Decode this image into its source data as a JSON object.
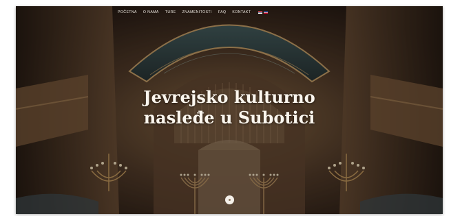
{
  "nav": {
    "items": [
      "POČETNA",
      "O NAMA",
      "TURE",
      "ZNAMENITOSTI",
      "FAQ",
      "KONTAKT"
    ],
    "languages": [
      "rs-flag-icon",
      "en-flag-icon"
    ]
  },
  "hero": {
    "title_line1": "Jevrejsko kulturno",
    "title_line2": "nasleđe u Subotici"
  },
  "scroll_icon": "scroll-down-icon",
  "colors": {
    "overlay_tone": "#2e2219",
    "gold": "#c9a36a",
    "text": "#fbf6ee"
  }
}
